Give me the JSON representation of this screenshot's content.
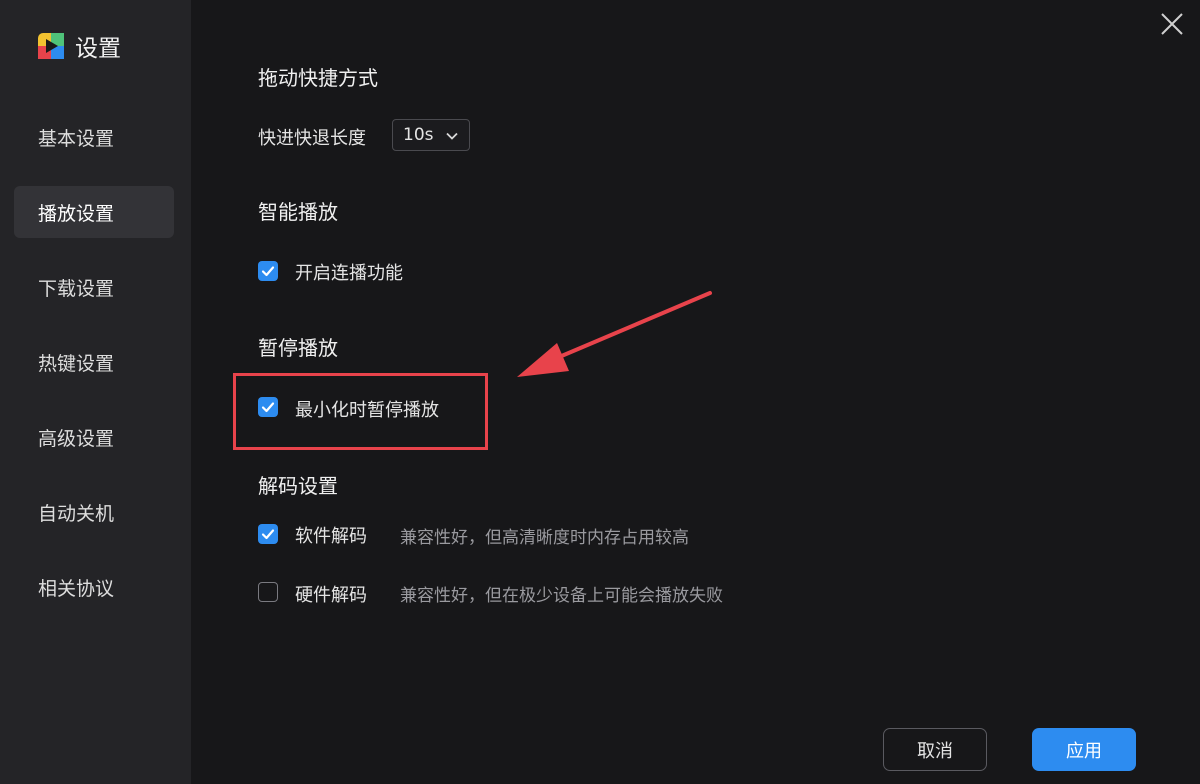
{
  "app": {
    "title": "设置",
    "logo_icon": "app-logo-icon"
  },
  "sidebar": {
    "items": [
      {
        "label": "基本设置",
        "active": false
      },
      {
        "label": "播放设置",
        "active": true
      },
      {
        "label": "下载设置",
        "active": false
      },
      {
        "label": "热键设置",
        "active": false
      },
      {
        "label": "高级设置",
        "active": false
      },
      {
        "label": "自动关机",
        "active": false
      },
      {
        "label": "相关协议",
        "active": false
      }
    ]
  },
  "sections": {
    "drag": {
      "title": "拖动快捷方式",
      "seek_label": "快进快退长度",
      "seek_value": "10s"
    },
    "smart": {
      "title": "智能播放",
      "continuous_label": "开启连播功能",
      "continuous_checked": true
    },
    "pause": {
      "title": "暂停播放",
      "minimize_label": "最小化时暂停播放",
      "minimize_checked": true
    },
    "decode": {
      "title": "解码设置",
      "software_label": "软件解码",
      "software_desc": "兼容性好，但高清晰度时内存占用较高",
      "software_checked": true,
      "hardware_label": "硬件解码",
      "hardware_desc": "兼容性好，但在极少设备上可能会播放失败",
      "hardware_checked": false
    }
  },
  "footer": {
    "cancel_label": "取消",
    "apply_label": "应用"
  },
  "colors": {
    "accent": "#2d8cf0",
    "annotation": "#e8434b",
    "background": "#171719",
    "sidebar": "#242427"
  }
}
